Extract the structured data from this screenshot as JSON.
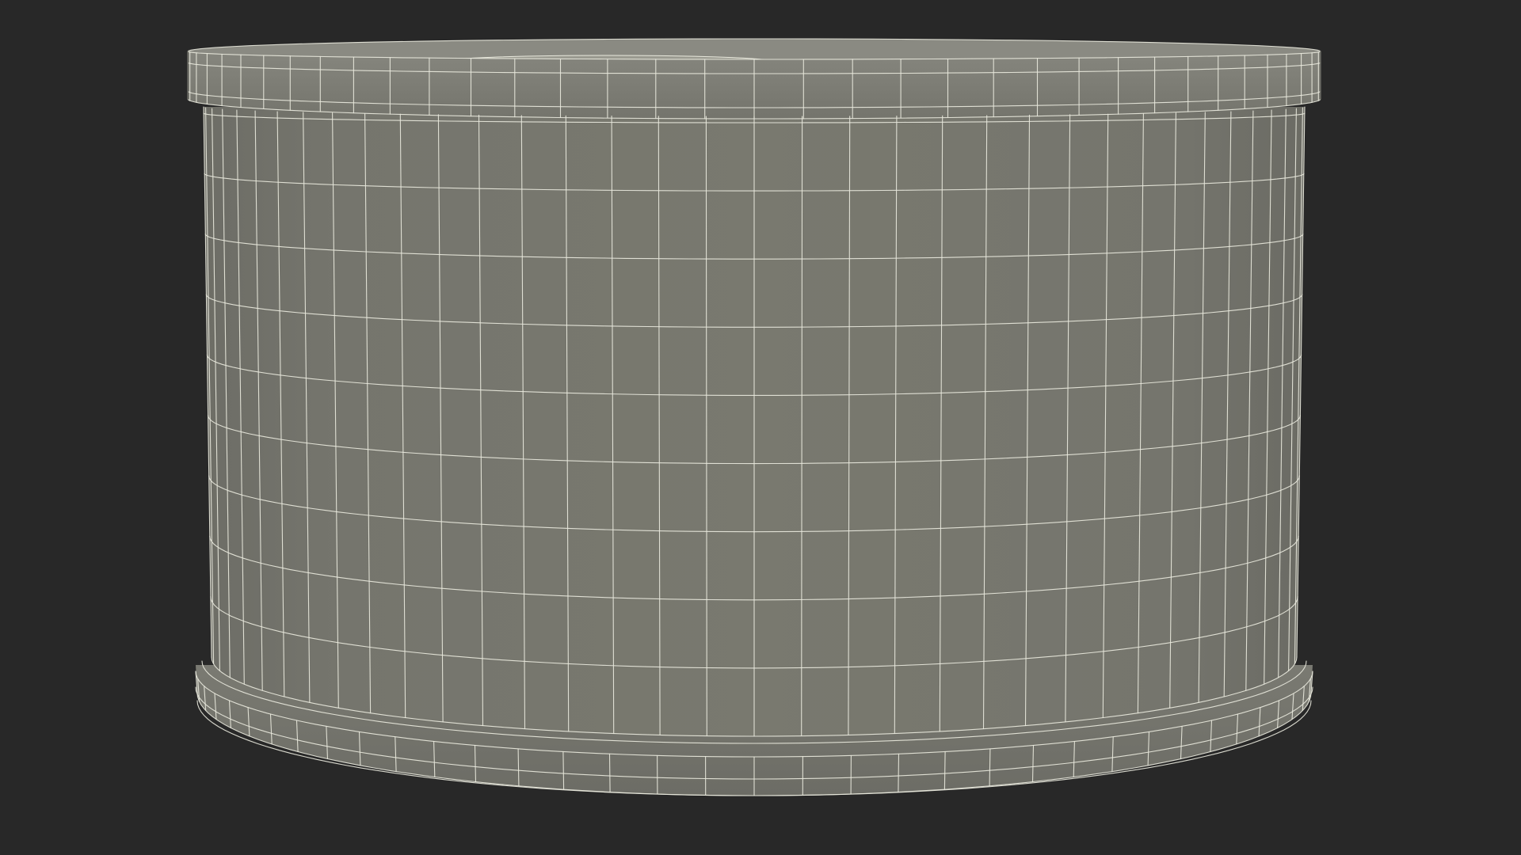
{
  "scene": {
    "background_color": "#282828",
    "object": "cylindrical-can-wireframe",
    "surface_color": "#77776f",
    "rim_color": "#7f7f77",
    "wire_color": "#e8e8dc",
    "vertical_segments": 36,
    "body_horizontal_rings": 8
  }
}
